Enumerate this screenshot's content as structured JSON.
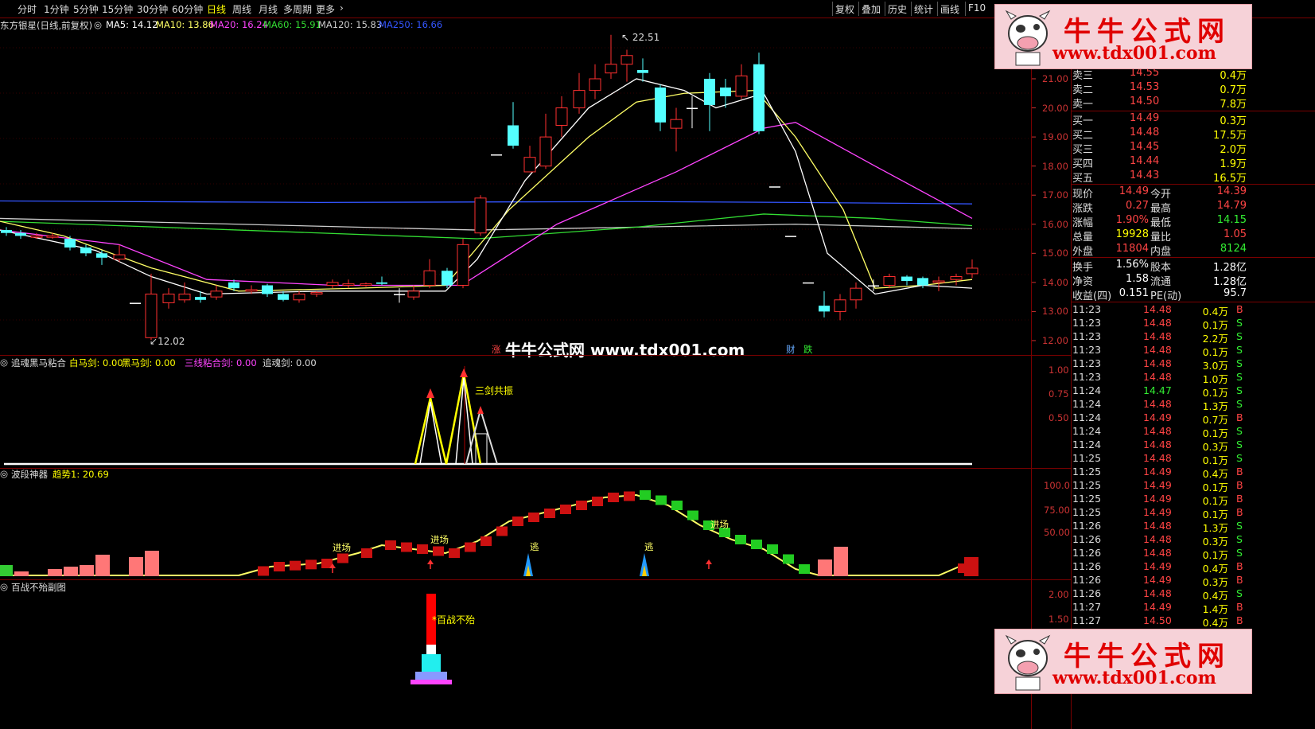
{
  "toolbar": {
    "timeframes": [
      "分时",
      "1分钟",
      "5分钟",
      "15分钟",
      "30分钟",
      "60分钟",
      "日线",
      "周线",
      "月线",
      "多周期",
      "更多"
    ],
    "active": "日线",
    "right_buttons": [
      "复权",
      "叠加",
      "历史",
      "统计",
      "画线",
      "F10"
    ]
  },
  "main_chart": {
    "stock_title": "东方银星(日线,前复权)",
    "ma": [
      {
        "label": "MA5: 14.12",
        "color": "#ffffff"
      },
      {
        "label": "MA10: 13.86",
        "color": "#ffff66"
      },
      {
        "label": "MA20: 16.24",
        "color": "#ff44ff"
      },
      {
        "label": "MA60: 15.91",
        "color": "#33dd33"
      },
      {
        "label": "MA120: 15.83",
        "color": "#cccccc"
      },
      {
        "label": "MA250: 16.66",
        "color": "#3355ff"
      }
    ],
    "high_label": "22.51",
    "low_label": "12.02",
    "y_ticks": [
      "21.00",
      "20.00",
      "19.00",
      "18.00",
      "17.00",
      "16.00",
      "15.00",
      "14.00",
      "13.00",
      "12.00"
    ],
    "markers": {
      "rise": "涨",
      "fin": "财",
      "fall": "跌"
    },
    "watermark": "牛牛公式网 www.tdx001.com"
  },
  "panel_sword": {
    "title": "追魂黑马粘合",
    "items": [
      {
        "label": "白马剑: 0.00",
        "color": "#ffff00"
      },
      {
        "label": "黑马剑: 0.00",
        "color": "#ffff00"
      },
      {
        "label": "三线粘合剑: 0.00",
        "color": "#ff44ff"
      },
      {
        "label": "追魂剑: 0.00",
        "color": "#dddddd"
      }
    ],
    "annotation": "三剑共振",
    "y_ticks": [
      "1.00",
      "0.75",
      "0.50"
    ]
  },
  "panel_wave": {
    "title": "波段神器",
    "trend_label": "趋势1: 20.69",
    "y_ticks": [
      "100.0",
      "75.00",
      "50.00"
    ],
    "entry_label": "进场",
    "escape_label": "逃"
  },
  "panel_bz": {
    "title": "百战不殆副图",
    "annotation": "百战不殆",
    "y_ticks": [
      "2.00",
      "1.50"
    ]
  },
  "quotes": {
    "sells": [
      {
        "name": "卖三",
        "price": "14.55",
        "vol": "0.4万"
      },
      {
        "name": "卖二",
        "price": "14.53",
        "vol": "0.7万"
      },
      {
        "name": "卖一",
        "price": "14.50",
        "vol": "7.8万"
      }
    ],
    "buys": [
      {
        "name": "买一",
        "price": "14.49",
        "vol": "0.3万"
      },
      {
        "name": "买二",
        "price": "14.48",
        "vol": "17.5万"
      },
      {
        "name": "买三",
        "price": "14.45",
        "vol": "2.0万"
      },
      {
        "name": "买四",
        "price": "14.44",
        "vol": "1.9万"
      },
      {
        "name": "买五",
        "price": "14.43",
        "vol": "16.5万"
      }
    ],
    "stats1": [
      {
        "l": "现价",
        "v": "14.49",
        "v_color": "#ff4444",
        "l2": "今开",
        "v2": "14.39",
        "v2_color": "#ff4444"
      },
      {
        "l": "涨跌",
        "v": "0.27",
        "v_color": "#ff4444",
        "l2": "最高",
        "v2": "14.79",
        "v2_color": "#ff4444"
      },
      {
        "l": "涨幅",
        "v": "1.90%",
        "v_color": "#ff4444",
        "l2": "最低",
        "v2": "14.15",
        "v2_color": "#33ee33"
      },
      {
        "l": "总量",
        "v": "19928",
        "v_color": "#ffff00",
        "l2": "量比",
        "v2": "1.05",
        "v2_color": "#ff4444"
      },
      {
        "l": "外盘",
        "v": "11804",
        "v_color": "#ff4444",
        "l2": "内盘",
        "v2": "8124",
        "v2_color": "#33ee33"
      }
    ],
    "stats2": [
      {
        "l": "换手",
        "v": "1.56%",
        "l2": "股本",
        "v2": "1.28亿"
      },
      {
        "l": "净资",
        "v": "1.58",
        "l2": "流通",
        "v2": "1.28亿"
      },
      {
        "l": "收益(四)",
        "v": "0.151",
        "l2": "PE(动)",
        "v2": "95.7"
      }
    ]
  },
  "ticks": [
    {
      "t": "11:23",
      "p": "14.48",
      "v": "0.4万",
      "s": "B"
    },
    {
      "t": "11:23",
      "p": "14.48",
      "v": "0.1万",
      "s": "S"
    },
    {
      "t": "11:23",
      "p": "14.48",
      "v": "2.2万",
      "s": "S"
    },
    {
      "t": "11:23",
      "p": "14.48",
      "v": "0.1万",
      "s": "S"
    },
    {
      "t": "11:23",
      "p": "14.48",
      "v": "3.0万",
      "s": "S"
    },
    {
      "t": "11:23",
      "p": "14.48",
      "v": "1.0万",
      "s": "S"
    },
    {
      "t": "11:24",
      "p": "14.47",
      "v": "0.1万",
      "s": "S"
    },
    {
      "t": "11:24",
      "p": "14.48",
      "v": "1.3万",
      "s": "S"
    },
    {
      "t": "11:24",
      "p": "14.49",
      "v": "0.7万",
      "s": "B"
    },
    {
      "t": "11:24",
      "p": "14.48",
      "v": "0.1万",
      "s": "S"
    },
    {
      "t": "11:24",
      "p": "14.48",
      "v": "0.3万",
      "s": "S"
    },
    {
      "t": "11:25",
      "p": "14.48",
      "v": "0.1万",
      "s": "S"
    },
    {
      "t": "11:25",
      "p": "14.49",
      "v": "0.4万",
      "s": "B"
    },
    {
      "t": "11:25",
      "p": "14.49",
      "v": "0.1万",
      "s": "B"
    },
    {
      "t": "11:25",
      "p": "14.49",
      "v": "0.1万",
      "s": "B"
    },
    {
      "t": "11:25",
      "p": "14.49",
      "v": "0.1万",
      "s": "B"
    },
    {
      "t": "11:26",
      "p": "14.48",
      "v": "1.3万",
      "s": "S"
    },
    {
      "t": "11:26",
      "p": "14.48",
      "v": "0.3万",
      "s": "S"
    },
    {
      "t": "11:26",
      "p": "14.48",
      "v": "0.1万",
      "s": "S"
    },
    {
      "t": "11:26",
      "p": "14.49",
      "v": "0.4万",
      "s": "B"
    },
    {
      "t": "11:26",
      "p": "14.49",
      "v": "0.3万",
      "s": "B"
    },
    {
      "t": "11:26",
      "p": "14.48",
      "v": "0.4万",
      "s": "S"
    },
    {
      "t": "11:27",
      "p": "14.49",
      "v": "1.4万",
      "s": "B"
    },
    {
      "t": "11:27",
      "p": "14.50",
      "v": "0.4万",
      "s": "B"
    }
  ],
  "logo": {
    "title": "牛牛公式网",
    "url": "www.tdx001.com"
  }
}
